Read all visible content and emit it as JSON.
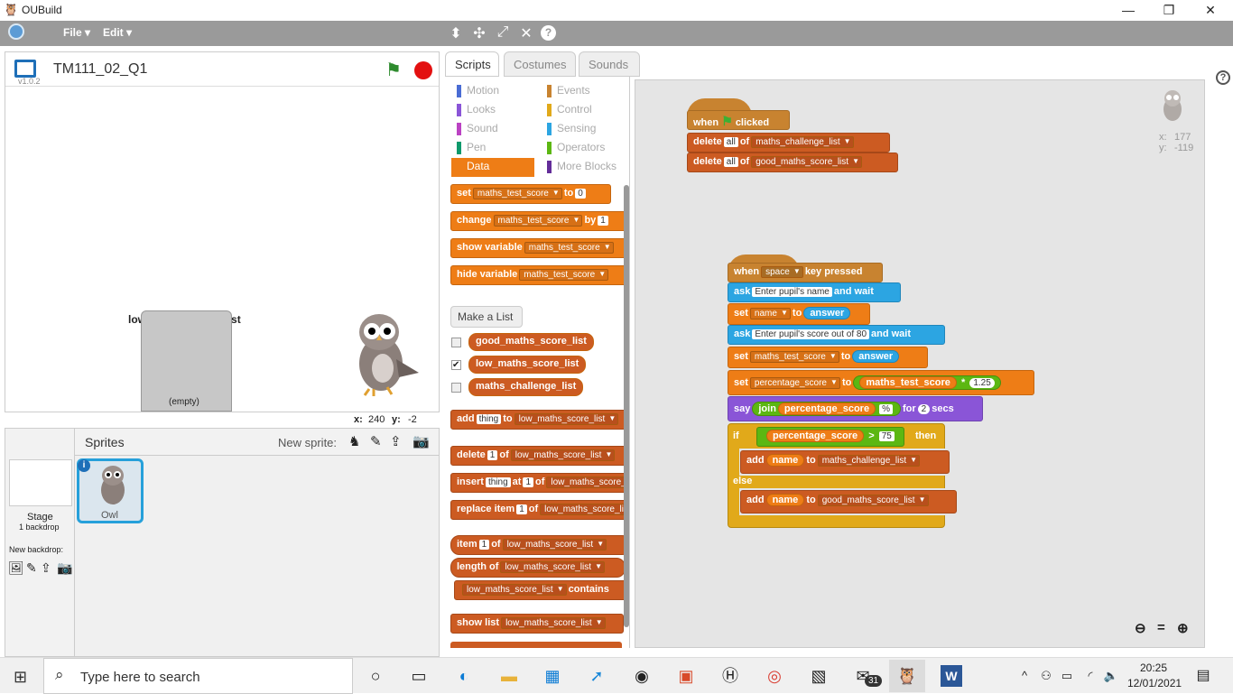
{
  "window": {
    "title": "OUBuild",
    "minimize": "—",
    "maximize": "❐",
    "close": "✕"
  },
  "menubar": {
    "file": "File ▾",
    "edit": "Edit ▾"
  },
  "stage": {
    "project_title": "TM111_02_Q1",
    "version": "v1.0.2",
    "list_monitor_title": "low_maths_score_list",
    "list_monitor_empty": "(empty)",
    "x_label": "x:",
    "x_value": "240",
    "y_label": "y:",
    "y_value": "-2"
  },
  "sprites": {
    "header": "Sprites",
    "new_sprite": "New sprite:",
    "stage_label": "Stage",
    "stage_backdrops": "1 backdrop",
    "new_backdrop": "New backdrop:",
    "sprite_name": "Owl"
  },
  "tabs": [
    "Scripts",
    "Costumes",
    "Sounds"
  ],
  "categories_left": [
    "Motion",
    "Looks",
    "Sound",
    "Pen",
    "Data"
  ],
  "categories_right": [
    "Events",
    "Control",
    "Sensing",
    "Operators",
    "More Blocks"
  ],
  "category_colors": {
    "Motion": "#4a6cd4",
    "Looks": "#8a55d7",
    "Sound": "#bb42c3",
    "Pen": "#0e9a6c",
    "Data": "#ee7d16",
    "Events": "#c88330",
    "Control": "#e1a91a",
    "Sensing": "#2ca5e2",
    "Operators": "#5cb712",
    "More Blocks": "#632d99"
  },
  "palette": {
    "set_var": {
      "kw": "set",
      "var": "maths_test_score",
      "to": "to",
      "val": "0"
    },
    "change_var": {
      "kw": "change",
      "var": "maths_test_score",
      "by": "by",
      "val": "1"
    },
    "show_var": {
      "kw": "show variable",
      "var": "maths_test_score"
    },
    "hide_var": {
      "kw": "hide variable",
      "var": "maths_test_score"
    },
    "make_list": "Make a List",
    "lists": [
      "good_maths_score_list",
      "low_maths_score_list",
      "maths_challenge_list"
    ],
    "add": {
      "kw": "add",
      "val": "thing",
      "to": "to",
      "list": "low_maths_score_list"
    },
    "delete": {
      "kw": "delete",
      "val": "1",
      "of": "of",
      "list": "low_maths_score_list"
    },
    "insert": {
      "kw": "insert",
      "val": "thing",
      "at": "at",
      "idx": "1",
      "of": "of",
      "list": "low_maths_score_list"
    },
    "replace": {
      "kw": "replace item",
      "idx": "1",
      "of": "of",
      "list": "low_maths_score_list"
    },
    "item": {
      "kw": "item",
      "idx": "1",
      "of": "of",
      "list": "low_maths_score_list"
    },
    "length": {
      "kw": "length of",
      "list": "low_maths_score_list"
    },
    "contains": {
      "list": "low_maths_score_list",
      "kw": "contains"
    },
    "show_list": {
      "kw": "show list",
      "list": "low_maths_score_list"
    }
  },
  "script1": {
    "hat": {
      "when": "when",
      "clicked": "clicked"
    },
    "del1": {
      "kw": "delete",
      "all": "all",
      "of": "of",
      "list": "maths_challenge_list"
    },
    "del2": {
      "kw": "delete",
      "all": "all",
      "of": "of",
      "list": "good_maths_score_list"
    }
  },
  "script2": {
    "hat": {
      "when": "when",
      "key": "space",
      "pressed": "key pressed"
    },
    "ask1": {
      "kw": "ask",
      "text": "Enter pupil's name",
      "wait": "and wait"
    },
    "set1": {
      "kw": "set",
      "var": "name",
      "to": "to",
      "val": "answer"
    },
    "ask2": {
      "kw": "ask",
      "text": "Enter pupil's score out of 80",
      "wait": "and wait"
    },
    "set2": {
      "kw": "set",
      "var": "maths_test_score",
      "to": "to",
      "val": "answer"
    },
    "set3": {
      "kw": "set",
      "var": "percentage_score",
      "to": "to",
      "rep": "maths_test_score",
      "op": "*",
      "num": "1.25"
    },
    "say": {
      "kw": "say",
      "join": "join",
      "rep": "percentage_score",
      "pct": "%",
      "for": "for",
      "secs_val": "2",
      "secs": "secs"
    },
    "if": {
      "kw": "if",
      "rep": "percentage_score",
      "op": ">",
      "num": "75",
      "then": "then"
    },
    "add1": {
      "kw": "add",
      "rep": "name",
      "to": "to",
      "list": "maths_challenge_list"
    },
    "else": "else",
    "add2": {
      "kw": "add",
      "rep": "name",
      "to": "to",
      "list": "good_maths_score_list"
    }
  },
  "sprite_info": {
    "x_label": "x:",
    "x": "177",
    "y_label": "y:",
    "y": "-119"
  },
  "taskbar": {
    "search": "Type here to search",
    "time": "20:25",
    "date": "12/01/2021",
    "mail_badge": "31"
  }
}
